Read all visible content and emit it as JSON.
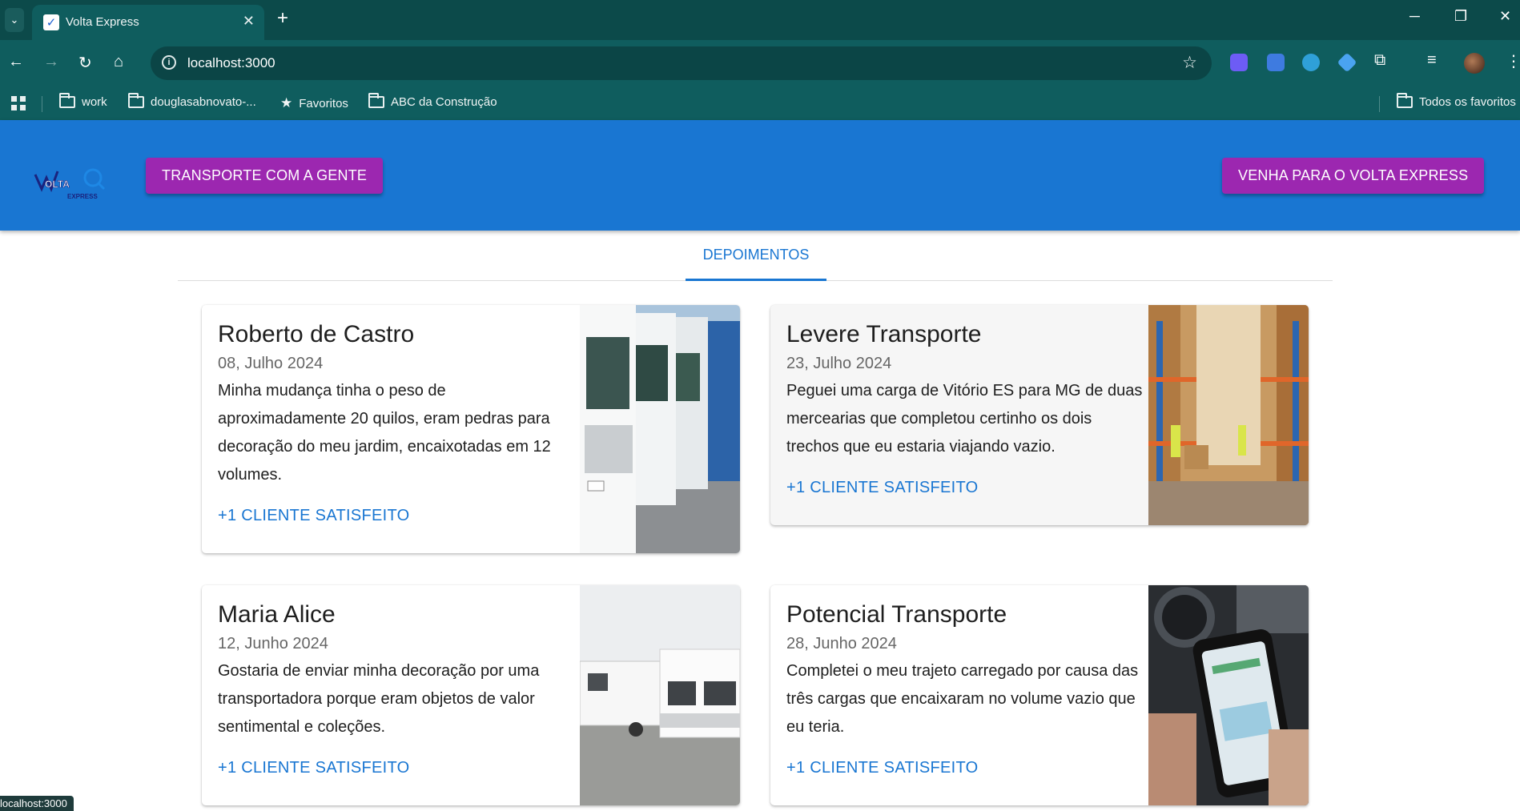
{
  "browser": {
    "tab_title": "Volta Express",
    "url": "localhost:3000",
    "bookmarks": [
      "work",
      "douglasabnovato-...",
      "Favoritos",
      "ABC da Construção"
    ],
    "all_bookmarks": "Todos os favoritos",
    "status_url": "localhost:3000"
  },
  "header": {
    "logo_text": "VOLTA EXPRESS",
    "btn_transport": "TRANSPORTE COM A GENTE",
    "btn_join": "VENHA PARA O VOLTA EXPRESS"
  },
  "tabs": {
    "active": "DEPOIMENTOS"
  },
  "testimonials": [
    {
      "name": "Roberto de Castro",
      "date": "08, Julho 2024",
      "text": "Minha mudança tinha o peso de aproximadamente 20 quilos, eram pedras para decoração do meu jardim, encaixotadas em 12 volumes.",
      "cta": "+1 CLIENTE SATISFEITO",
      "image": "trucks"
    },
    {
      "name": "Levere Transporte",
      "date": "23, Julho 2024",
      "text": "Peguei uma carga de Vitório ES para MG de duas mercearias que completou certinho os dois trechos que eu estaria viajando vazio.",
      "cta": "+1 CLIENTE SATISFEITO",
      "image": "warehouse"
    },
    {
      "name": "Maria Alice",
      "date": "12, Junho 2024",
      "text": "Gostaria de enviar minha decoração por uma transportadora porque eram objetos de valor sentimental e coleções.",
      "cta": "+1 CLIENTE SATISFEITO",
      "image": "vans"
    },
    {
      "name": "Potencial Transporte",
      "date": "28, Junho 2024",
      "text": "Completei o meu trajeto carregado por causa das três cargas que encaixaram no volume vazio que eu teria.",
      "cta": "+1 CLIENTE SATISFEITO",
      "image": "phone-in-car"
    }
  ],
  "colors": {
    "primary": "#1976d2",
    "accent": "#9c27b0",
    "chrome": "#0f5d5e"
  }
}
